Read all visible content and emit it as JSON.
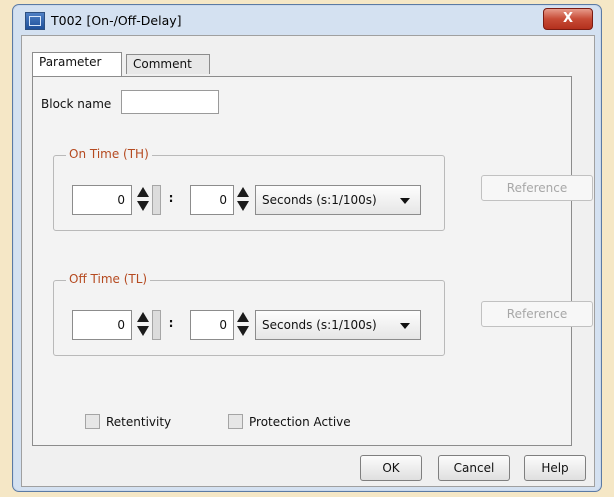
{
  "window": {
    "title": "T002 [On-/Off-Delay]",
    "close_glyph": "X",
    "icon": "app-icon"
  },
  "tabs": [
    {
      "label": "Parameter",
      "active": true
    },
    {
      "label": "Comment",
      "active": false
    }
  ],
  "block_name": {
    "label": "Block name",
    "value": ""
  },
  "on_time": {
    "legend": "On Time (TH)",
    "value1": "0",
    "value2": "0",
    "colon": ":",
    "unit": "Seconds (s:1/100s)",
    "reference_label": "Reference"
  },
  "off_time": {
    "legend": "Off Time (TL)",
    "value1": "0",
    "value2": "0",
    "colon": ":",
    "unit": "Seconds (s:1/100s)",
    "reference_label": "Reference"
  },
  "options": {
    "retentivity": "Retentivity",
    "protection_active": "Protection Active"
  },
  "buttons": {
    "ok": "OK",
    "cancel": "Cancel",
    "help": "Help"
  },
  "colors": {
    "legend": "#b54a20",
    "close_button": "#c74b36",
    "page_background": "#f5e7c6"
  }
}
